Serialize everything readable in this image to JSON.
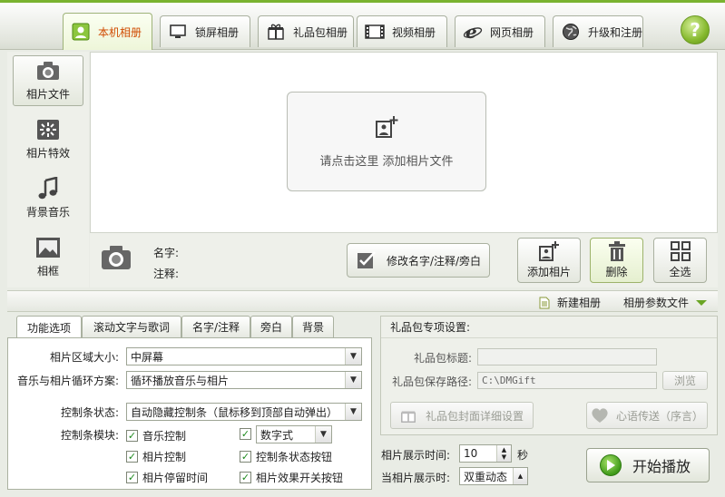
{
  "tabs": [
    {
      "label": "本机相册",
      "icon": "portrait-icon",
      "active": true
    },
    {
      "label": "锁屏相册",
      "icon": "monitor-icon",
      "active": false
    },
    {
      "label": "礼品包相册",
      "icon": "gift-icon",
      "active": false
    },
    {
      "label": "视频相册",
      "icon": "film-icon",
      "active": false
    },
    {
      "label": "网页相册",
      "icon": "ie-icon",
      "active": false
    },
    {
      "label": "升级和注册",
      "icon": "globe-icon",
      "active": false
    }
  ],
  "help_label": "?",
  "sidebar": {
    "items": [
      {
        "label": "相片文件",
        "icon": "camera-icon",
        "active": true
      },
      {
        "label": "相片特效",
        "icon": "effects-icon",
        "active": false
      },
      {
        "label": "背景音乐",
        "icon": "music-note-icon",
        "active": false
      },
      {
        "label": "相框",
        "icon": "frame-icon",
        "active": false
      }
    ]
  },
  "main": {
    "add_prompt": "请点击这里 添加相片文件"
  },
  "info": {
    "name_label": "名字:",
    "note_label": "注释:",
    "edit_button": "修改名字/注释/旁白",
    "add_button": "添加相片",
    "delete_button": "删除",
    "select_all_button": "全选"
  },
  "menubar": {
    "new_album": "新建相册",
    "album_params": "相册参数文件"
  },
  "options": {
    "tabs": [
      "功能选项",
      "滚动文字与歌词",
      "名字/注释",
      "旁白",
      "背景"
    ],
    "photo_area_label": "相片区域大小:",
    "photo_area_value": "中屏幕",
    "loop_label": "音乐与相片循环方案:",
    "loop_value": "循环播放音乐与相片",
    "control_state_label": "控制条状态:",
    "control_state_value": "自动隐藏控制条（鼠标移到顶部自动弹出）",
    "control_module_label": "控制条模块:",
    "checks": [
      {
        "label": "音乐控制",
        "checked": true
      },
      {
        "label": "数字式",
        "checked": true
      },
      {
        "label": "相片控制",
        "checked": true
      },
      {
        "label": "控制条状态按钮",
        "checked": true
      },
      {
        "label": "相片停留时间",
        "checked": true
      },
      {
        "label": "相片效果开关按钮",
        "checked": true
      }
    ]
  },
  "gift": {
    "header": "礼品包专项设置:",
    "title_label": "礼品包标题:",
    "title_value": "",
    "path_label": "礼品包保存路径:",
    "path_value": "C:\\DMGift",
    "browse_button": "浏览",
    "cover_button": "礼品包封面详细设置",
    "heart_button": "心语传送（序言）"
  },
  "playback": {
    "time_label": "相片展示时间:",
    "time_value": "10",
    "time_unit": "秒",
    "display_label": "当相片展示时:",
    "display_value": "双重动态",
    "play_button": "开始播放"
  }
}
